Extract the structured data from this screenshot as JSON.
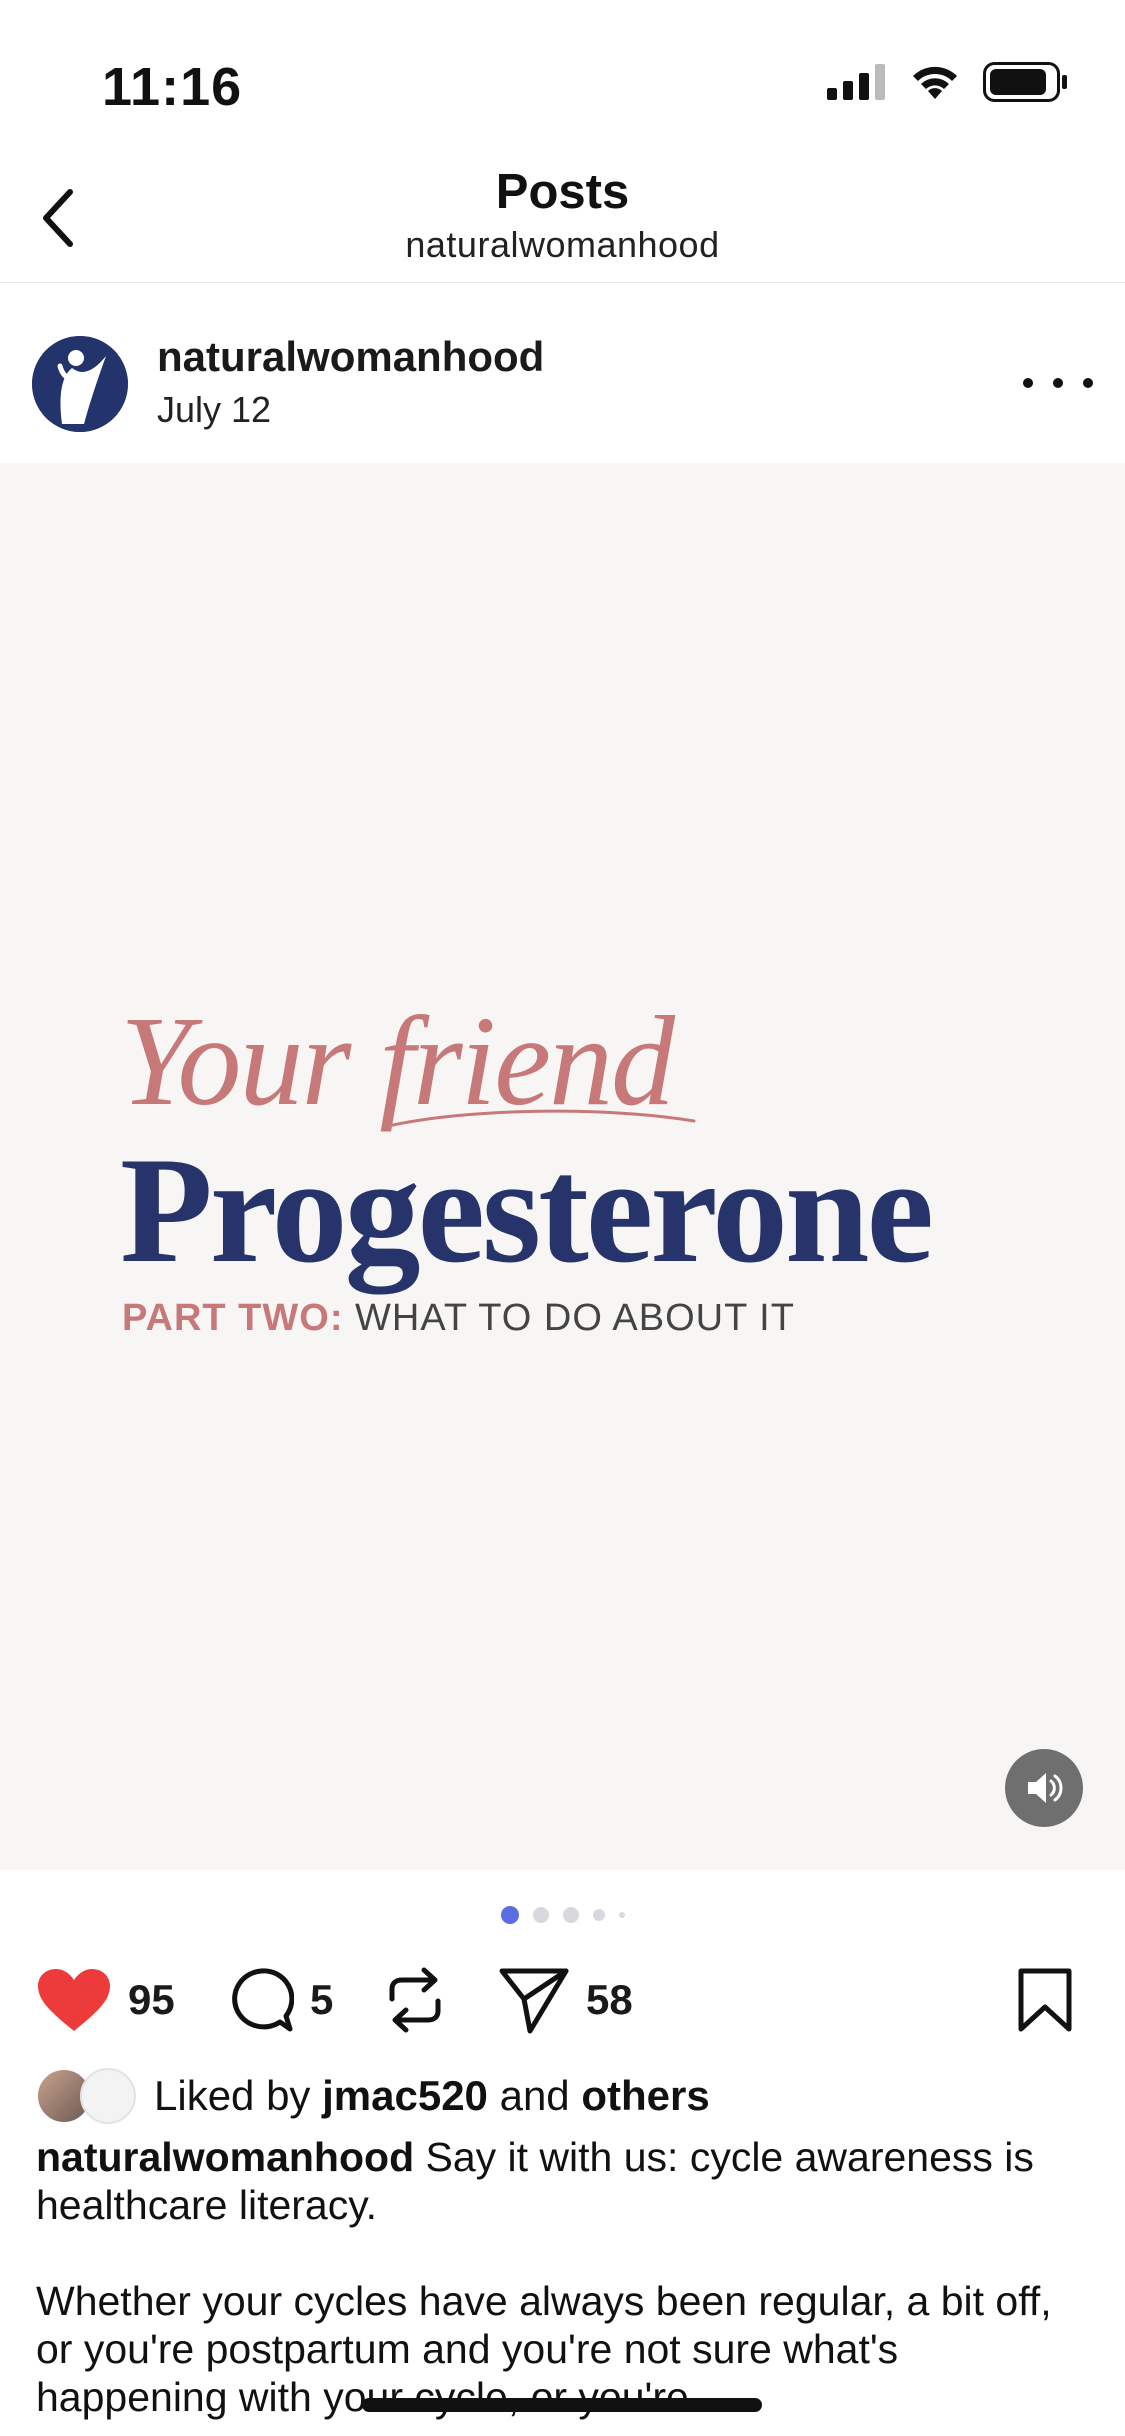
{
  "status_bar": {
    "time": "11:16",
    "battery_level": 0.8
  },
  "nav": {
    "title": "Posts",
    "subtitle": "naturalwomanhood"
  },
  "post": {
    "username": "naturalwomanhood",
    "date": "July 12",
    "media": {
      "line1": "Your friend",
      "line2": "Progesterone",
      "part_label": "PART TWO:",
      "part_text": " WHAT TO DO ABOUT IT"
    },
    "carousel": {
      "total": 5,
      "active_index": 0
    },
    "likes_count": "95",
    "comments_count": "5",
    "shares_count": "58",
    "liked_by_prefix": "Liked by ",
    "liked_by_user": "jmac520",
    "liked_by_mid": " and ",
    "liked_by_others": "others",
    "caption_user": "naturalwomanhood",
    "caption_text": " Say it with us: cycle awareness is healthcare literacy.",
    "caption_more": "Whether your cycles have always been regular, a bit off, or you're postpartum and you're not sure what's happening with your cycle, or you're"
  },
  "colors": {
    "accent_pink": "#c7797a",
    "accent_navy": "#26346b",
    "like_red": "#ed3b3b",
    "active_dot": "#5b6ee1"
  }
}
